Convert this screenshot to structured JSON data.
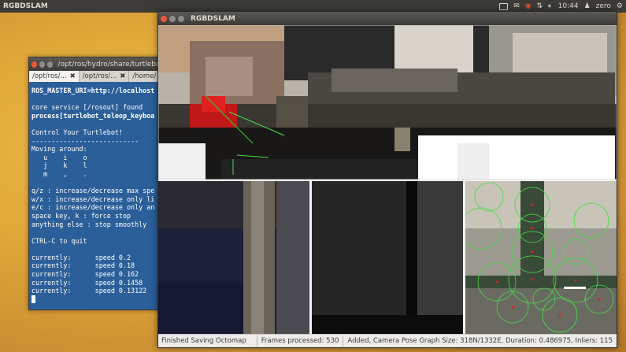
{
  "topbar": {
    "app_name": "RGBDSLAM",
    "clock": "10:44",
    "user": "zero",
    "icons": [
      "keyboard-icon",
      "mail-icon",
      "chat-icon",
      "network-icon",
      "volume-icon",
      "settings-gear-icon"
    ]
  },
  "terminal": {
    "title": "/opt/ros/hydro/share/turtlebot",
    "tabs": [
      {
        "label": "/opt/ros/..."
      },
      {
        "label": "/opt/ros/..."
      },
      {
        "label": "/home/"
      }
    ],
    "lines": [
      {
        "text": "ROS_MASTER_URI=http://localhost",
        "bold": true
      },
      {
        "text": ""
      },
      {
        "text": "core service [/rosout] found"
      },
      {
        "text": "process[turtlebot_teleop_keyboa",
        "bold": true
      },
      {
        "text": ""
      },
      {
        "text": "Control Your Turtlebot!"
      },
      {
        "text": "---------------------------"
      },
      {
        "text": "Moving around:"
      },
      {
        "text": "   u    i    o"
      },
      {
        "text": "   j    k    l"
      },
      {
        "text": "   m    ,    ."
      },
      {
        "text": ""
      },
      {
        "text": "q/z : increase/decrease max spe"
      },
      {
        "text": "w/x : increase/decrease only li"
      },
      {
        "text": "e/c : increase/decrease only an"
      },
      {
        "text": "space key, k : force stop"
      },
      {
        "text": "anything else : stop smoothly"
      },
      {
        "text": ""
      },
      {
        "text": "CTRL-C to quit"
      },
      {
        "text": ""
      },
      {
        "text": "currently:      speed 0.2"
      },
      {
        "text": "currently:      speed 0.18"
      },
      {
        "text": "currently:      speed 0.162"
      },
      {
        "text": "currently:      speed 0.1458"
      },
      {
        "text": "currently:      speed 0.13122"
      }
    ]
  },
  "slam": {
    "title": "RGBDSLAM",
    "status": {
      "message": "Finished Saving Octomap",
      "frames": "Frames processed: 530",
      "details": "Added, Camera Pose Graph Size: 318N/1332E, Duration: 0.486975, Inliers:  115"
    }
  }
}
